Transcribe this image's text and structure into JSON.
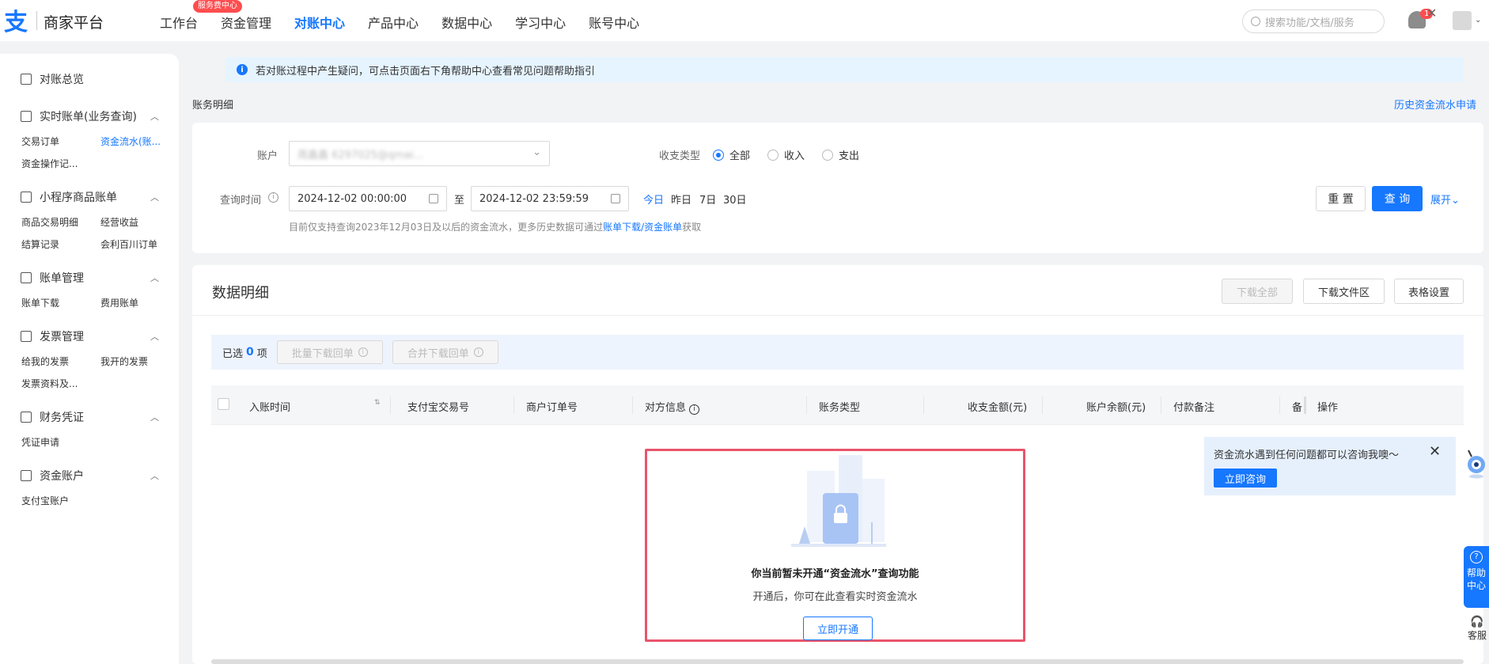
{
  "header": {
    "logo_glyph": "支",
    "brand": "商家平台",
    "nav": [
      "工作台",
      "资金管理",
      "对账中心",
      "产品中心",
      "数据中心",
      "学习中心",
      "账号中心"
    ],
    "nav_badge": "服务费中心",
    "search_placeholder": "搜索功能/文档/服务",
    "bell_count": "1"
  },
  "sidebar": {
    "overview": "对账总览",
    "groups": [
      {
        "label": "实时账单(业务查询)",
        "items": [
          "交易订单",
          "资金流水(账...",
          "资金操作记..."
        ]
      },
      {
        "label": "小程序商品账单",
        "items": [
          "商品交易明细",
          "经营收益",
          "结算记录",
          "会利百川订单"
        ]
      },
      {
        "label": "账单管理",
        "items": [
          "账单下载",
          "费用账单"
        ]
      },
      {
        "label": "发票管理",
        "items": [
          "给我的发票",
          "我开的发票",
          "发票资料及..."
        ]
      },
      {
        "label": "财务凭证",
        "items": [
          "凭证申请"
        ]
      },
      {
        "label": "资金账户",
        "items": [
          "支付宝账户"
        ]
      }
    ]
  },
  "notice": "若对账过程中产生疑问，可点击页面右下角帮助中心查看常见问题帮助指引",
  "breadcrumb": "账务明细",
  "history_link": "历史资金流水申请",
  "filter": {
    "account_label": "账户",
    "account_value": "周鑫鑫                 6297025@qmai...",
    "type_label": "收支类型",
    "types": [
      "全部",
      "收入",
      "支出"
    ],
    "time_label": "查询时间",
    "start": "2024-12-02 00:00:00",
    "to": "至",
    "end": "2024-12-02 23:59:59",
    "quick": [
      "今日",
      "昨日",
      "7日",
      "30日"
    ],
    "reset": "重 置",
    "query": "查 询",
    "expand": "展开",
    "hint_prefix": "目前仅支持查询2023年12月03日及以后的资金流水，更多历史数据可通过",
    "hint_link": "账单下载/资金账单",
    "hint_suffix": "获取"
  },
  "data": {
    "title": "数据明细",
    "download_all": "下载全部",
    "download_area": "下载文件区",
    "table_settings": "表格设置",
    "selected_prefix": "已选",
    "selected_count": "0",
    "selected_suffix": "项",
    "batch_download": "批量下载回单",
    "merge_download": "合并下载回单",
    "columns": [
      "入账时间",
      "支付宝交易号",
      "商户订单号",
      "对方信息",
      "账务类型",
      "收支金额(元)",
      "账户余额(元)",
      "付款备注",
      "备",
      "操作"
    ]
  },
  "empty": {
    "title": "你当前暂未开通“资金流水”查询功能",
    "sub": "开通后，你可在此查看实时资金流水",
    "button": "立即开通"
  },
  "tip": {
    "text": "资金流水遇到任何问题都可以咨询我噢～",
    "button": "立即咨询"
  },
  "help": {
    "l1": "帮助",
    "l2": "中心",
    "kefu": "客服"
  },
  "colors": {
    "accent": "#1677ff",
    "highlight_border": "#e9546b"
  }
}
